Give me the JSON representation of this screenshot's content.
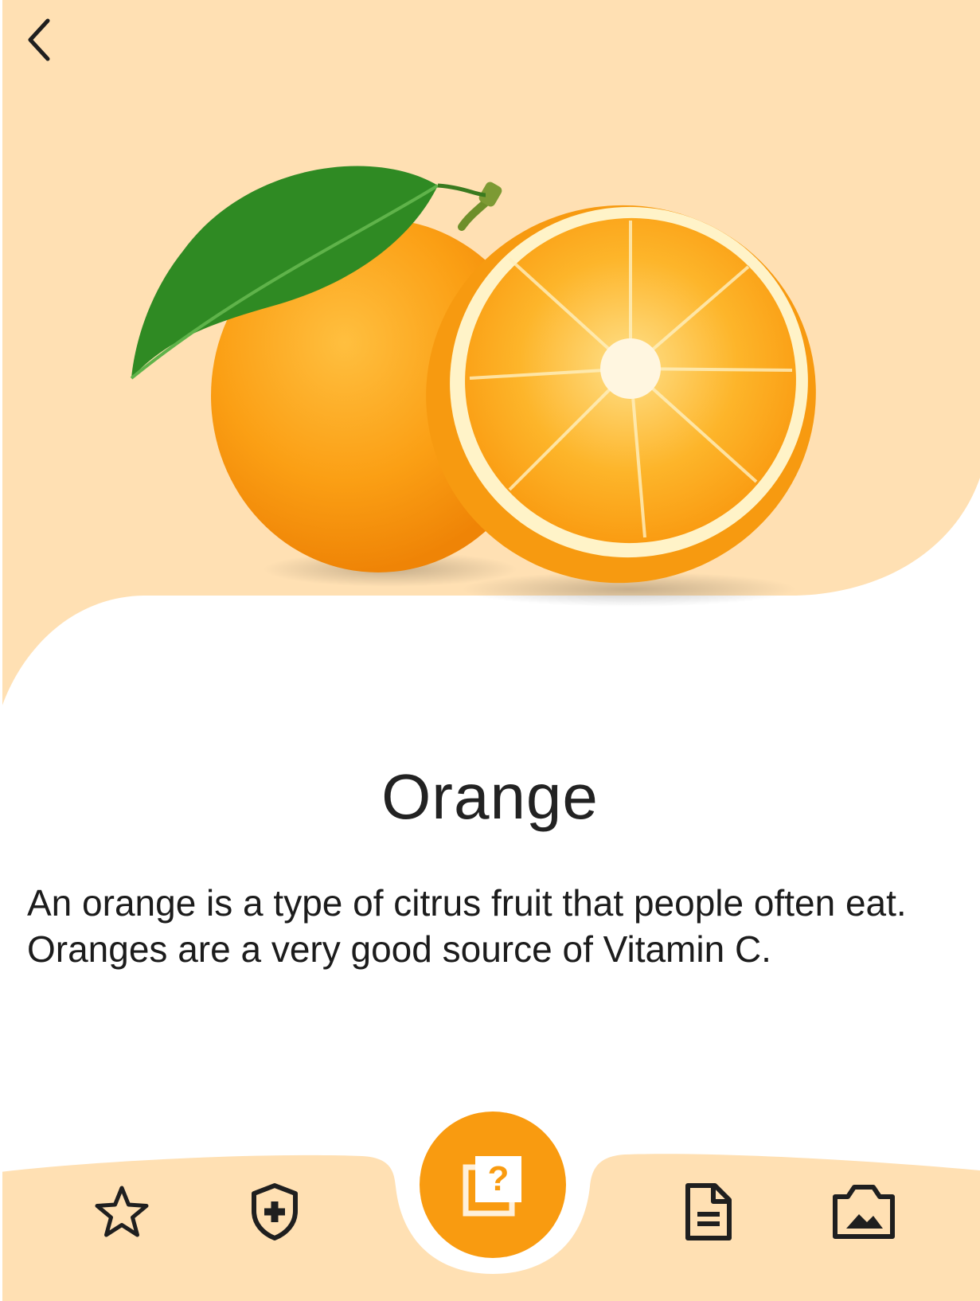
{
  "product": {
    "title": "Orange",
    "description": "An orange is a type of citrus fruit that people often eat. Oranges are a very good source of Vitamin C."
  },
  "colors": {
    "header_background": "#ffe0b3",
    "accent": "#f99b10",
    "text": "#222222",
    "icon": "#1f1f1f"
  },
  "icons": {
    "back": "chevron-left-icon",
    "favorite": "star-icon",
    "health": "shield-plus-icon",
    "quiz": "quiz-cards-icon",
    "document": "document-icon",
    "gallery": "photo-icon"
  }
}
